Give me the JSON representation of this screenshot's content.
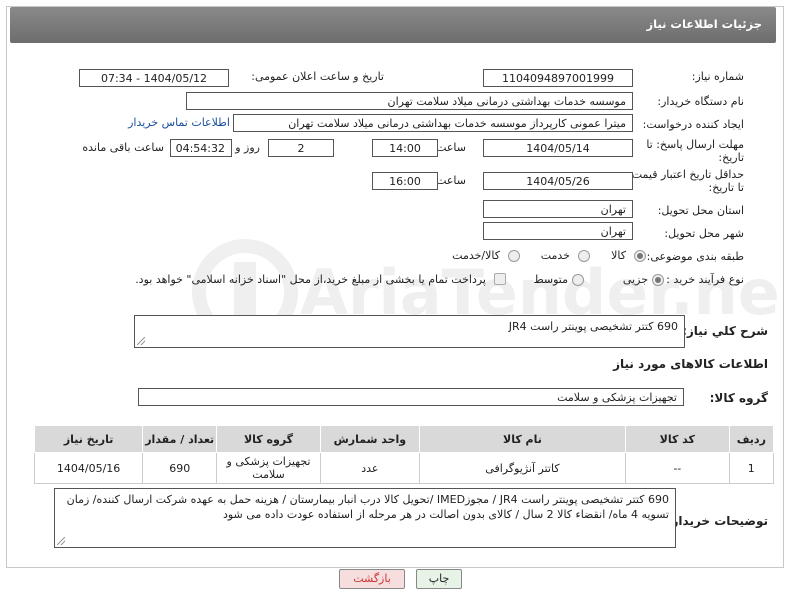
{
  "header": {
    "title": "جزئیات اطلاعات نیاز"
  },
  "fields": {
    "need_number_label": "شماره نیاز:",
    "need_number": "1104094897001999",
    "announce_label": "تاریخ و ساعت اعلان عمومی:",
    "announce_value": "1404/05/12 - 07:34",
    "buyer_org_label": "نام دستگاه خریدار:",
    "buyer_org": "موسسه خدمات بهداشتی درمانی میلاد سلامت تهران",
    "creator_label": "ایجاد کننده درخواست:",
    "creator": "میترا عمونی کارپرداز موسسه خدمات بهداشتی درمانی میلاد سلامت تهران",
    "contact_link": "اطلاعات تماس خریدار",
    "reply_deadline_label_1": "مهلت ارسال پاسخ: تا",
    "reply_deadline_label_2": "تاریخ:",
    "reply_date": "1404/05/14",
    "time_label": "ساعت",
    "reply_time": "14:00",
    "days_value": "2",
    "days_label": "روز و",
    "remaining_time": "04:54:32",
    "remaining_label": "ساعت باقی مانده",
    "price_deadline_label_1": "حداقل تاریخ اعتبار قیمت:",
    "price_deadline_label_2": "تا تاریخ:",
    "price_date": "1404/05/26",
    "price_time": "16:00",
    "province_label": "استان محل تحویل:",
    "province": "تهران",
    "city_label": "شهر محل تحویل:",
    "city": "تهران",
    "category_label": "طبقه بندی موضوعی:",
    "category_options": [
      "کالا",
      "خدمت",
      "کالا/خدمت"
    ],
    "process_label": "نوع فرآیند خرید :",
    "process_options": [
      "جزیی",
      "متوسط"
    ],
    "payment_note": "پرداخت تمام یا بخشی از مبلغ خرید،از محل \"اسناد خزانه اسلامی\" خواهد بود."
  },
  "summary": {
    "label": "شرح كلي نياز:",
    "value": "690 کتتر تشخیصی پوینتر راست JR4"
  },
  "goods": {
    "section_title": "اطلاعات کالاهای مورد نیاز",
    "group_label": "گروه کالا:",
    "group_value": "تجهیزات پزشکی و سلامت",
    "columns": [
      "ردیف",
      "کد کالا",
      "نام کالا",
      "واحد شمارش",
      "گروه کالا",
      "تعداد / مقدار",
      "تاریخ نیاز"
    ],
    "rows": [
      [
        "1",
        "--",
        "کاتتر آنژیوگرافی",
        "عدد",
        "تجهیزات پزشکی و سلامت",
        "690",
        "1404/05/16"
      ]
    ]
  },
  "buyer_notes": {
    "label": "توضیحات خریدار:",
    "value": "690 کتتر تشخیصی پوینتر راست JR4 / مجوزIMED /تحویل کالا درب انبار بیمارستان / هزینه حمل به عهده شرکت ارسال کننده/ زمان تسویه 4 ماه/ انقضاء کالا 2 سال / کالای بدون اصالت در هر مرحله از استفاده عودت داده می شود"
  },
  "buttons": {
    "print": "چاپ",
    "back": "بازگشت"
  },
  "watermark": {
    "text": "AriaTender.net"
  },
  "colors": {
    "header_bg": "#777777",
    "link": "#1a4fa0",
    "back_btn": "#f6dede",
    "print_btn": "#e6f3e6"
  }
}
